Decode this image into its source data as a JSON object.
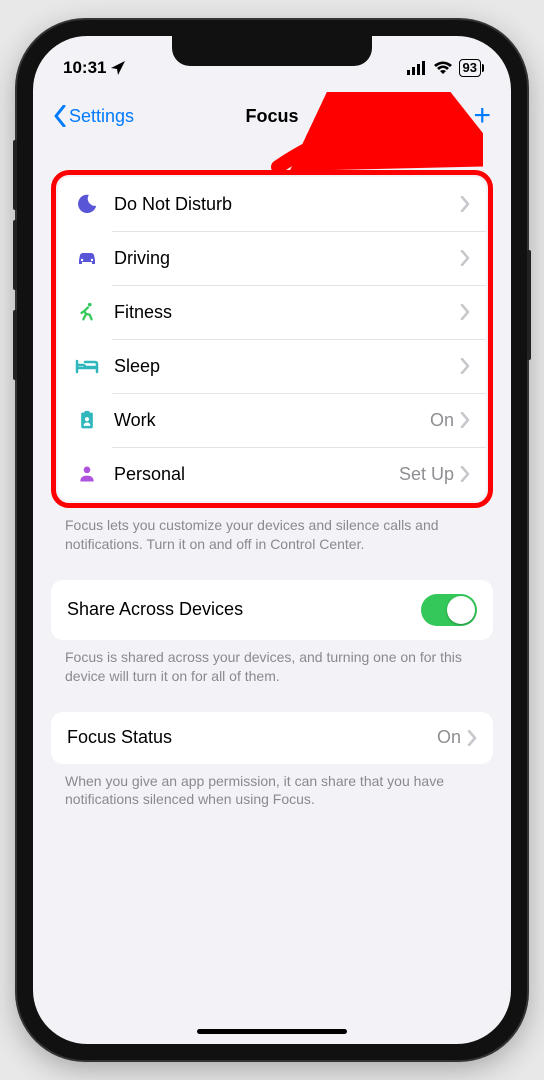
{
  "status": {
    "time": "10:31",
    "battery": "93"
  },
  "nav": {
    "back": "Settings",
    "title": "Focus"
  },
  "focus_modes": [
    {
      "label": "Do Not Disturb",
      "detail": "",
      "icon": "moon",
      "color": "#5856d6"
    },
    {
      "label": "Driving",
      "detail": "",
      "icon": "car",
      "color": "#5856d6"
    },
    {
      "label": "Fitness",
      "detail": "",
      "icon": "runner",
      "color": "#34c759"
    },
    {
      "label": "Sleep",
      "detail": "",
      "icon": "bed",
      "color": "#2fb7bd"
    },
    {
      "label": "Work",
      "detail": "On",
      "icon": "badge",
      "color": "#2fb7bd"
    },
    {
      "label": "Personal",
      "detail": "Set Up",
      "icon": "person",
      "color": "#af52de"
    }
  ],
  "footer1": "Focus lets you customize your devices and silence calls and notifications. Turn it on and off in Control Center.",
  "share": {
    "label": "Share Across Devices"
  },
  "footer2": "Focus is shared across your devices, and turning one on for this device will turn it on for all of them.",
  "focus_status": {
    "label": "Focus Status",
    "detail": "On"
  },
  "footer3": "When you give an app permission, it can share that you have notifications silenced when using Focus."
}
